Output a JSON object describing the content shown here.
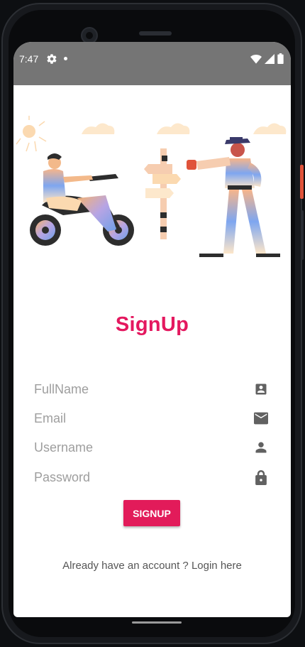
{
  "status_bar": {
    "time": "7:47",
    "icons": [
      "gear-icon",
      "notification-dot",
      "wifi-icon",
      "signal-icon",
      "battery-icon"
    ]
  },
  "form": {
    "title": "SignUp",
    "fields": [
      {
        "placeholder": "FullName",
        "icon": "contact-card-icon"
      },
      {
        "placeholder": "Email",
        "icon": "mail-icon"
      },
      {
        "placeholder": "Username",
        "icon": "person-icon"
      },
      {
        "placeholder": "Password",
        "icon": "lock-icon"
      }
    ],
    "submit_label": "SIGNUP",
    "login_text": "Already have an account ? Login here"
  },
  "colors": {
    "accent": "#e4185f",
    "button": "#e21b5a",
    "statusbar": "#757575",
    "icon": "#616161"
  }
}
